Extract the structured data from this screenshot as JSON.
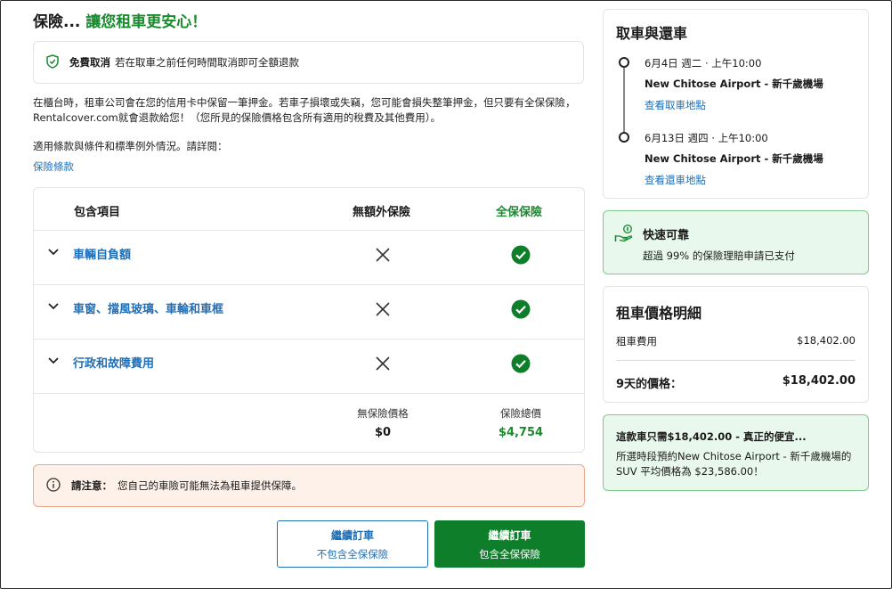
{
  "heading": {
    "prefix": "保險...",
    "highlight": "讓您租車更安心！"
  },
  "free_cancel": {
    "icon": "shield-check-icon",
    "title": "免費取消",
    "text": "若在取車之前任何時間取消即可全額退款"
  },
  "intro_text": "在櫃台時，租車公司會在您的信用卡中保留一筆押金。若車子損壞或失竊，您可能會損失整筆押金，但只要有全保保險，Rentalcover.com就會退款給您！（您所見的保險價格包含所有適用的稅費及其他費用）。",
  "terms_text": "適用條款與條件和標準例外情況。請詳閱：",
  "policy_link": "保險條款",
  "coverage": {
    "col_item": "包含項目",
    "col_none": "無額外保險",
    "col_full": "全保保險",
    "rows": [
      {
        "label": "車輛自負額",
        "none": "not-covered",
        "full": "covered"
      },
      {
        "label": "車窗、擋風玻璃、車輪和車框",
        "none": "not-covered",
        "full": "covered"
      },
      {
        "label": "行政和故障費用",
        "none": "not-covered",
        "full": "covered"
      }
    ],
    "price_none_label": "無保險價格",
    "price_none_value": "$0",
    "price_full_label": "保險總價",
    "price_full_value": "$4,754"
  },
  "notice": {
    "icon": "info-circle-icon",
    "title": "請注意：",
    "text": "您自己的車險可能無法為租車提供保障。"
  },
  "buttons": {
    "without": {
      "line1": "繼續訂車",
      "line2": "不包含全保保險"
    },
    "with": {
      "line1": "繼續訂車",
      "line2": "包含全保保險"
    }
  },
  "trip": {
    "title": "取車與還車",
    "pickup": {
      "date": "6月4日 週二 · 上午10:00",
      "place": "New Chitose Airport - 新千歲機場",
      "link": "查看取車地點"
    },
    "dropoff": {
      "date": "6月13日 週四 · 上午10:00",
      "place": "New Chitose Airport - 新千歲機場",
      "link": "查看還車地點"
    }
  },
  "fast": {
    "icon": "hand-coin-icon",
    "title": "快速可靠",
    "text": "超過 99% 的保險理賠申請已支付"
  },
  "price": {
    "title": "租車價格明細",
    "rental_label": "租車費用",
    "rental_value": "$18,402.00",
    "total_label": "9天的價格：",
    "total_value": "$18,402.00"
  },
  "deal": {
    "title": "這款車只需$18,402.00 - 真正的便宜...",
    "text": "所選時段預約New Chitose Airport - 新千歲機場的 SUV 平均價格為 $23,586.00！"
  },
  "colors": {
    "green": "#1a8a2e",
    "link": "#1f6fb8",
    "button_green": "#0f7e2a"
  }
}
